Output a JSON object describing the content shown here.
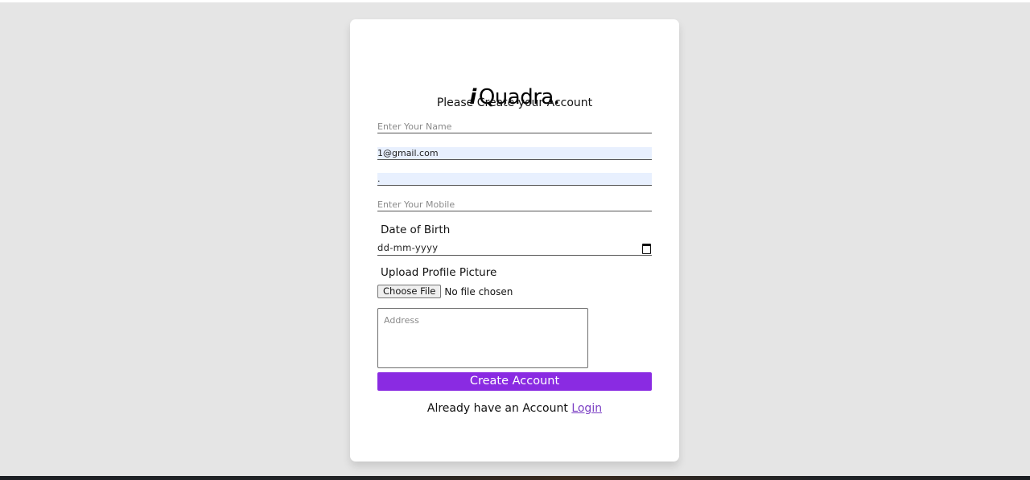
{
  "brand": {
    "logo_i": "i",
    "logo_text": "Quadra."
  },
  "form": {
    "subtitle": "Please Create your Account",
    "name": {
      "placeholder": "Enter Your Name",
      "value": ""
    },
    "email": {
      "value": "1@gmail.com"
    },
    "password": {
      "value": "."
    },
    "mobile": {
      "placeholder": "Enter Your Mobile",
      "value": ""
    },
    "dob": {
      "label": "Date of Birth",
      "placeholder": "dd-mm-yyyy"
    },
    "upload": {
      "label": "Upload Profile Picture",
      "button": "Choose File",
      "status": "No file chosen"
    },
    "address": {
      "placeholder": "Address"
    },
    "submit_label": "Create Account",
    "login_prompt": "Already have an Account",
    "login_link": "Login"
  },
  "colors": {
    "background": "#e5e5e5",
    "card": "#ffffff",
    "accent": "#8a2be2",
    "autofill": "#e8f0fe"
  }
}
